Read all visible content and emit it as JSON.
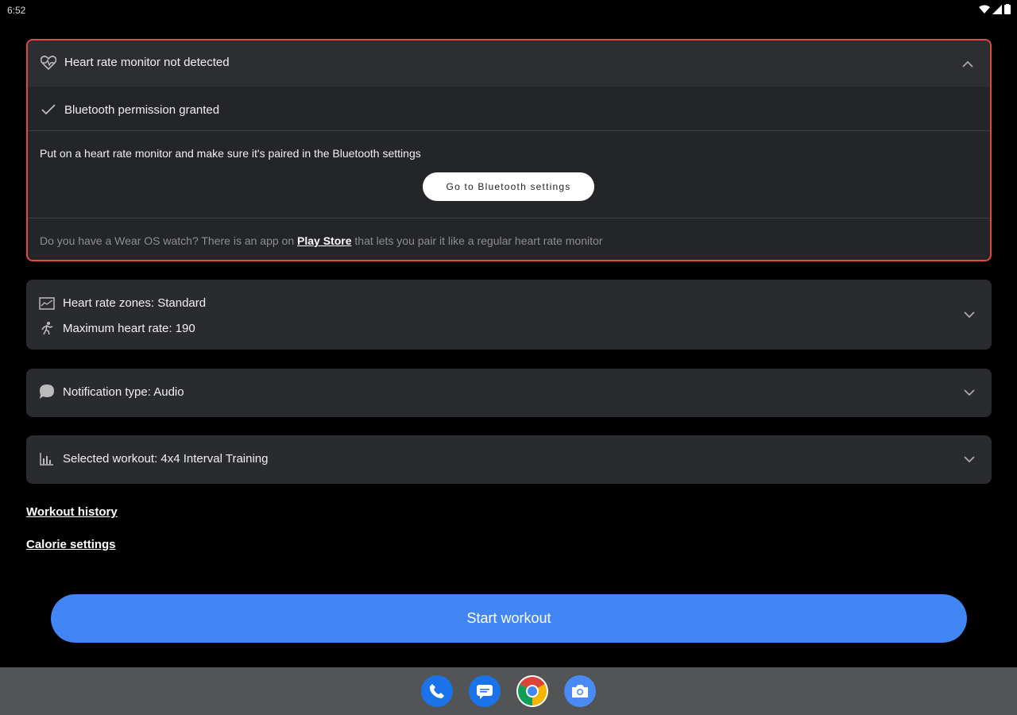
{
  "status_bar": {
    "time": "6:52"
  },
  "hr_monitor_card": {
    "title": "Heart rate monitor not detected",
    "permission_text": "Bluetooth permission granted",
    "instruction": "Put on a heart rate monitor and make sure it's paired in the Bluetooth settings",
    "bluetooth_button": "Go to Bluetooth settings",
    "wear_note_before": "Do you have a Wear OS watch? There is an app on ",
    "wear_note_link": "Play Store",
    "wear_note_after": " that lets you pair it like a regular heart rate monitor"
  },
  "zones_card": {
    "zones_text": "Heart rate zones: Standard",
    "max_hr_text": "Maximum heart rate: 190"
  },
  "notification_card": {
    "text": "Notification type: Audio"
  },
  "workout_card": {
    "text": "Selected workout: 4x4 Interval Training"
  },
  "links": {
    "history": "Workout history",
    "calories": "Calorie settings"
  },
  "start_button": "Start workout",
  "dock": {
    "apps": [
      "phone-icon",
      "messages-icon",
      "chrome-icon",
      "camera-icon"
    ]
  },
  "colors": {
    "accent": "#4285f4",
    "alert_border": "#e5473e",
    "card_bg": "#2a2b2e"
  }
}
